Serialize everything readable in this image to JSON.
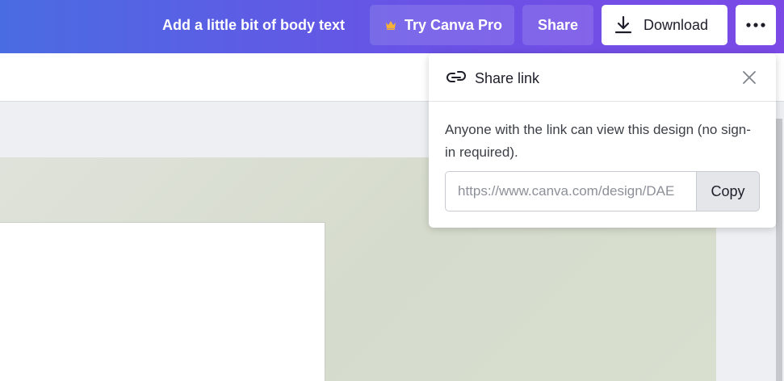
{
  "topbar": {
    "doc_title": "Add a little bit of body text",
    "pro_label": "Try Canva Pro",
    "share_label": "Share",
    "download_label": "Download",
    "more_icon": "more-horizontal-icon",
    "crown_color": "#f5b237"
  },
  "share_popover": {
    "title": "Share link",
    "description": "Anyone with the link can view this design (no sign-in required).",
    "url_value": "https://www.canva.com/design/DAE",
    "copy_label": "Copy"
  },
  "colors": {
    "header_gradient_start": "#4a6ce2",
    "header_gradient_end": "#7b4ae6",
    "canvas_background": "#d8ddd0"
  }
}
